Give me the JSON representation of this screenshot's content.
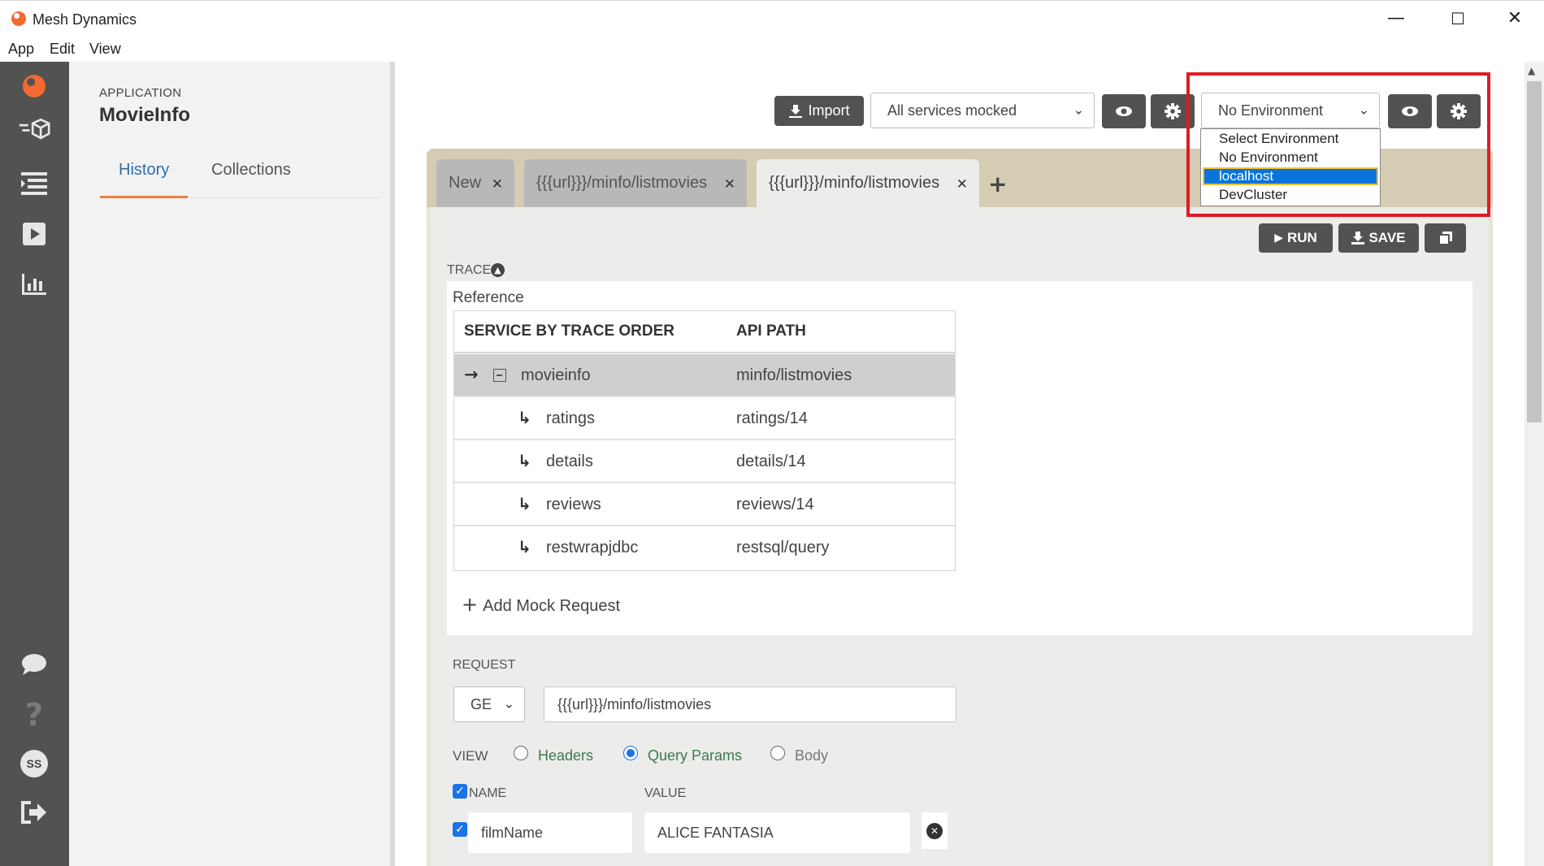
{
  "window": {
    "title": "Mesh Dynamics",
    "minimize": "—",
    "maximize": "☐",
    "close": "✕"
  },
  "menu": [
    "App",
    "Edit",
    "View"
  ],
  "rail": {
    "icons": [
      "logo-icon",
      "mock-services-icon",
      "test-suites-icon",
      "run-icon",
      "reports-icon",
      "chat-icon",
      "help-icon",
      "avatar",
      "logout-icon"
    ],
    "avatar_initials": "SS"
  },
  "side": {
    "app_label": "APPLICATION",
    "app_name": "MovieInfo",
    "tabs": [
      "History",
      "Collections"
    ],
    "active_tab": "History"
  },
  "toolbar": {
    "import_label": "Import",
    "mock_select_value": "All services mocked",
    "env_select_value": "No Environment"
  },
  "env_dropdown": {
    "options": [
      "Select Environment",
      "No Environment",
      "localhost",
      "DevCluster"
    ],
    "highlighted": "localhost"
  },
  "tabs": [
    {
      "label": "New",
      "active": false
    },
    {
      "label": "{{{url}}}/minfo/listmovies",
      "active": false
    },
    {
      "label": "{{{url}}}/minfo/listmovies",
      "active": true
    }
  ],
  "actions": {
    "run": "RUN",
    "save": "SAVE"
  },
  "trace": {
    "label": "TRACE",
    "reference_label": "Reference",
    "columns": [
      "SERVICE BY TRACE ORDER",
      "API PATH"
    ],
    "rows": [
      {
        "service": "movieinfo",
        "path": "minfo/listmovies",
        "selected": true
      },
      {
        "service": "ratings",
        "path": "ratings/14"
      },
      {
        "service": "details",
        "path": "details/14"
      },
      {
        "service": "reviews",
        "path": "reviews/14"
      },
      {
        "service": "restwrapjdbc",
        "path": "restsql/query"
      }
    ],
    "add_mock_label": "Add Mock Request"
  },
  "request": {
    "label": "REQUEST",
    "method": "GE",
    "url": "{{{url}}}/minfo/listmovies",
    "view_label": "VIEW",
    "views": [
      "Headers",
      "Query Params",
      "Body"
    ],
    "active_view": "Query Params",
    "params_header": {
      "name": "NAME",
      "value": "VALUE"
    },
    "params": [
      {
        "name": "filmName",
        "value": "ALICE FANTASIA",
        "enabled": true
      }
    ]
  },
  "colors": {
    "accent": "#f07d3a",
    "highlight_box": "#e01b24",
    "selection": "#0a74da",
    "dark_button": "#525252",
    "tab_strip": "#d6ccb4",
    "green_text": "#3d7a4a"
  }
}
